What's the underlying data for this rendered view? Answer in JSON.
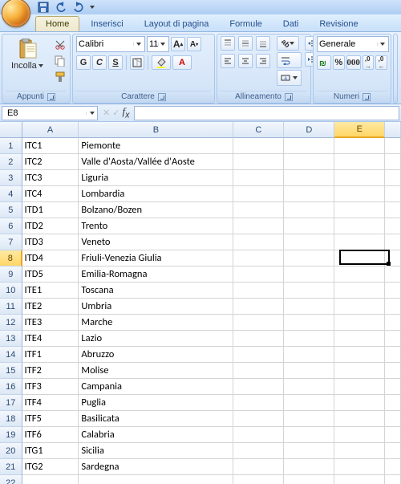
{
  "qat": {
    "save_tip": "Salva",
    "undo_tip": "Annulla",
    "redo_tip": "Ripeti"
  },
  "tabs": {
    "home": "Home",
    "insert": "Inserisci",
    "pagelayout": "Layout di pagina",
    "formulas": "Formule",
    "data": "Dati",
    "review": "Revisione"
  },
  "ribbon": {
    "clipboard": {
      "paste": "Incolla",
      "group": "Appunti"
    },
    "font": {
      "name": "Calibri",
      "size": "11",
      "bold": "G",
      "italic": "C",
      "underline": "S",
      "group": "Carattere"
    },
    "alignment": {
      "group": "Allineamento"
    },
    "number": {
      "format": "Generale",
      "group": "Numeri"
    }
  },
  "namebox": "E8",
  "formula": "",
  "columns": [
    "A",
    "B",
    "C",
    "D",
    "E"
  ],
  "rows": [
    {
      "n": 1,
      "a": "ITC1",
      "b": "Piemonte"
    },
    {
      "n": 2,
      "a": "ITC2",
      "b": "Valle d'Aosta/Vallée d'Aoste"
    },
    {
      "n": 3,
      "a": "ITC3",
      "b": "Liguria"
    },
    {
      "n": 4,
      "a": "ITC4",
      "b": "Lombardia"
    },
    {
      "n": 5,
      "a": "ITD1",
      "b": "Bolzano/Bozen"
    },
    {
      "n": 6,
      "a": "ITD2",
      "b": "Trento"
    },
    {
      "n": 7,
      "a": "ITD3",
      "b": "Veneto"
    },
    {
      "n": 8,
      "a": "ITD4",
      "b": "Friuli-Venezia Giulia"
    },
    {
      "n": 9,
      "a": "ITD5",
      "b": "Emilia-Romagna"
    },
    {
      "n": 10,
      "a": "ITE1",
      "b": "Toscana"
    },
    {
      "n": 11,
      "a": "ITE2",
      "b": "Umbria"
    },
    {
      "n": 12,
      "a": "ITE3",
      "b": "Marche"
    },
    {
      "n": 13,
      "a": "ITE4",
      "b": "Lazio"
    },
    {
      "n": 14,
      "a": "ITF1",
      "b": "Abruzzo"
    },
    {
      "n": 15,
      "a": "ITF2",
      "b": "Molise"
    },
    {
      "n": 16,
      "a": "ITF3",
      "b": "Campania"
    },
    {
      "n": 17,
      "a": "ITF4",
      "b": "Puglia"
    },
    {
      "n": 18,
      "a": "ITF5",
      "b": "Basilicata"
    },
    {
      "n": 19,
      "a": "ITF6",
      "b": "Calabria"
    },
    {
      "n": 20,
      "a": "ITG1",
      "b": "Sicilia"
    },
    {
      "n": 21,
      "a": "ITG2",
      "b": "Sardegna"
    },
    {
      "n": 22,
      "a": "",
      "b": ""
    }
  ],
  "active": {
    "col": "E",
    "row": 8
  }
}
